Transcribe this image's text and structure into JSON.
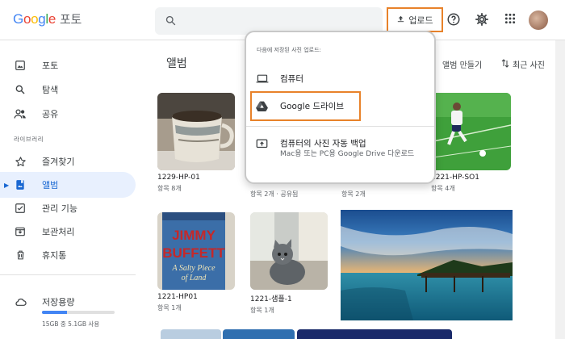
{
  "header": {
    "logo_product": "포토",
    "upload_label": "업로드"
  },
  "sidebar": {
    "items": [
      {
        "label": "포토",
        "icon": "photo-icon"
      },
      {
        "label": "탐색",
        "icon": "search-icon"
      },
      {
        "label": "공유",
        "icon": "people-icon"
      }
    ],
    "library_label": "라이브러리",
    "library_items": [
      {
        "label": "즐겨찾기",
        "icon": "star-icon"
      },
      {
        "label": "앨범",
        "icon": "album-icon",
        "active": true
      },
      {
        "label": "관리 기능",
        "icon": "checklist-icon"
      },
      {
        "label": "보관처리",
        "icon": "archive-icon"
      },
      {
        "label": "휴지통",
        "icon": "trash-icon"
      }
    ],
    "storage": {
      "label": "저장용량",
      "usage_text": "15GB 중 5.1GB 사용",
      "used_fraction": 0.34
    }
  },
  "main": {
    "title": "앨범",
    "create_album": "앨범 만들기",
    "sort_label": "최근 사진",
    "albums": [
      {
        "name": "1229-HP-01",
        "count": "항목 8개"
      },
      {
        "name": "1221-HP-SO1",
        "count": "항목 4개"
      },
      {
        "name": "1221-HP01",
        "count": "항목 1개"
      },
      {
        "name": "1221-샘플-1",
        "count": "항목 1개"
      }
    ],
    "partial_counts": [
      "항목 2개 · 공유됨",
      "항목 2개"
    ]
  },
  "dropdown": {
    "heading": "다음에 저장된 사진 업로드:",
    "items": [
      {
        "label": "컴퓨터",
        "icon": "laptop-icon"
      },
      {
        "label": "Google 드라이브",
        "icon": "google-drive-icon"
      },
      {
        "label": "컴퓨터의 사진 자동 백업",
        "icon": "upload-folder-icon",
        "sub": "Mac용 또는 PC용 Google Drive 다운로드"
      }
    ]
  },
  "colors": {
    "accent": "#1967d2",
    "highlight_border": "#e8822a",
    "active_bg": "#e8f0fe"
  }
}
